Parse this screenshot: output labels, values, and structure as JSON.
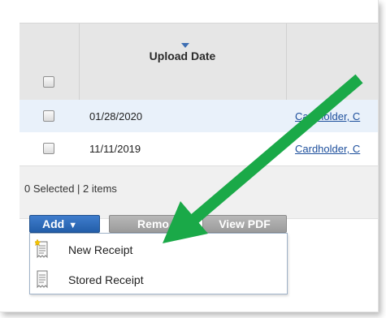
{
  "table": {
    "columns": {
      "upload_date": "Upload Date"
    },
    "rows": [
      {
        "upload_date": "01/28/2020",
        "cardholder": "Cardholder, C"
      },
      {
        "upload_date": "11/11/2019",
        "cardholder": "Cardholder, C"
      }
    ],
    "footer": "0 Selected | 2 items"
  },
  "toolbar": {
    "add_label": "Add",
    "remove_label": "Remo",
    "view_pdf_label": "View PDF"
  },
  "add_menu": {
    "items": [
      {
        "label": "New Receipt",
        "icon": "new-receipt-icon"
      },
      {
        "label": "Stored Receipt",
        "icon": "stored-receipt-icon"
      }
    ]
  },
  "colors": {
    "header_bg": "#e6e6e6",
    "selected_row_bg": "#e9f1fa",
    "add_button": "#2e6bbd",
    "link": "#1d4f9c",
    "annotation_arrow": "#1aa948"
  }
}
